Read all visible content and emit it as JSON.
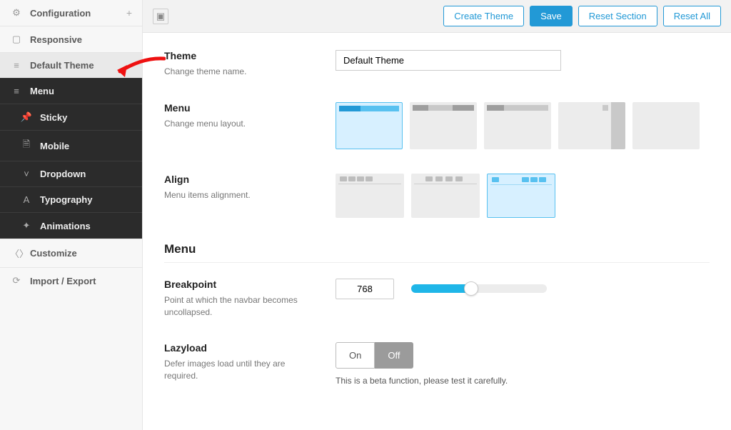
{
  "sidebar": {
    "items": [
      {
        "icon": "gear-icon",
        "label": "Configuration",
        "style": "light",
        "plus": true
      },
      {
        "icon": "tablet-icon",
        "label": "Responsive",
        "style": "light"
      },
      {
        "icon": "bars-icon",
        "label": "Default Theme",
        "style": "selected"
      },
      {
        "icon": "bars-icon",
        "label": "Menu",
        "style": "dark"
      },
      {
        "icon": "pin-icon",
        "label": "Sticky",
        "style": "dark sub"
      },
      {
        "icon": "file-icon",
        "label": "Mobile",
        "style": "dark sub"
      },
      {
        "icon": "chevron-icon",
        "label": "Dropdown",
        "style": "dark sub"
      },
      {
        "icon": "font-icon",
        "label": "Typography",
        "style": "dark sub"
      },
      {
        "icon": "spark-icon",
        "label": "Animations",
        "style": "dark sub"
      },
      {
        "icon": "code-icon",
        "label": "Customize",
        "style": "light"
      },
      {
        "icon": "refresh-icon",
        "label": "Import / Export",
        "style": "light"
      }
    ]
  },
  "topbar": {
    "buttons": {
      "create_theme": "Create Theme",
      "save": "Save",
      "reset_section": "Reset Section",
      "reset_all": "Reset All"
    }
  },
  "fields": {
    "theme": {
      "title": "Theme",
      "desc": "Change theme name.",
      "value": "Default Theme"
    },
    "menu": {
      "title": "Menu",
      "desc": "Change menu layout."
    },
    "align": {
      "title": "Align",
      "desc": "Menu items alignment."
    },
    "section2_title": "Menu",
    "breakpoint": {
      "title": "Breakpoint",
      "desc": "Point at which the navbar becomes uncollapsed.",
      "value": "768"
    },
    "lazyload": {
      "title": "Lazyload",
      "desc": "Defer images load until they are required.",
      "on": "On",
      "off": "Off",
      "hint": "This is a beta function, please test it carefully."
    }
  },
  "icons": {
    "gear-icon": "⚙",
    "tablet-icon": "▢",
    "bars-icon": "≡",
    "pin-icon": "📌",
    "file-icon": "🗎",
    "chevron-icon": "˅",
    "font-icon": "A",
    "spark-icon": "✦",
    "code-icon": "〈〉",
    "refresh-icon": "⟳",
    "align-icon": "▣"
  }
}
